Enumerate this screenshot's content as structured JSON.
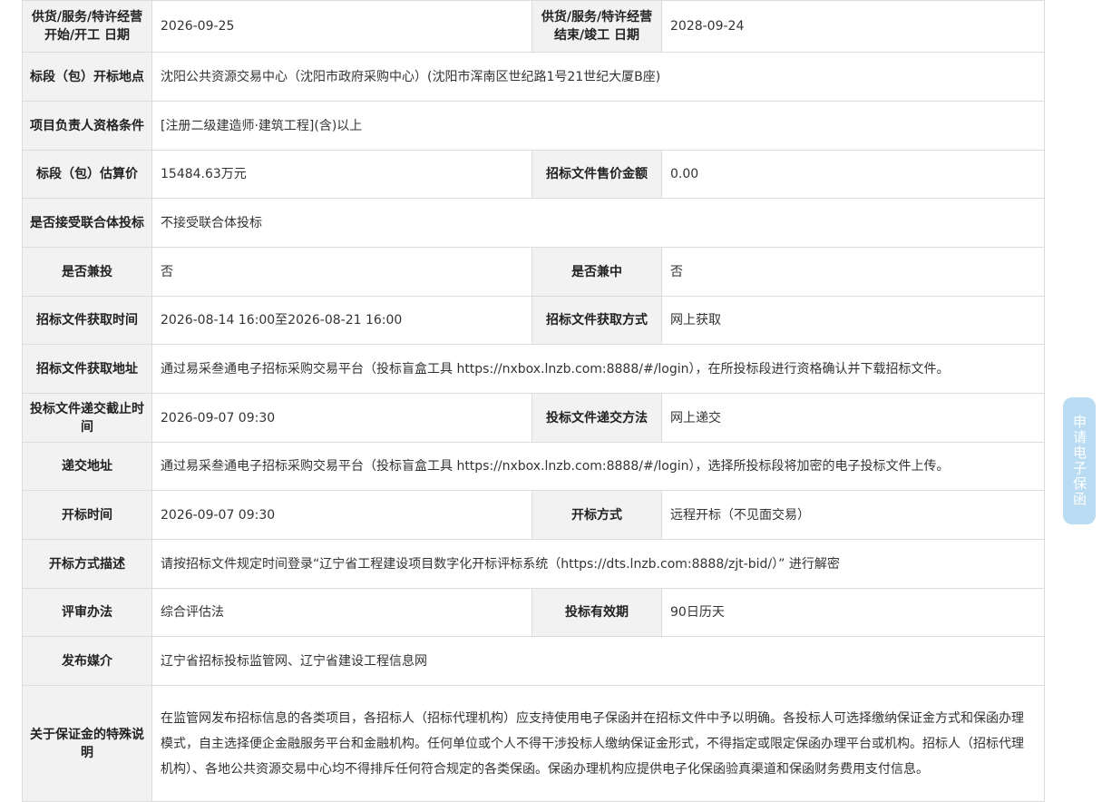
{
  "rows": {
    "start_date": {
      "label": "供货/服务/特许经营开始/开工 日期",
      "value": "2026-09-25"
    },
    "end_date": {
      "label": "供货/服务/特许经营结束/竣工 日期",
      "value": "2028-09-24"
    },
    "opening_location": {
      "label": "标段（包）开标地点",
      "value": "沈阳公共资源交易中心（沈阳市政府采购中心）(沈阳市浑南区世纪路1号21世纪大厦B座)"
    },
    "manager_qualification": {
      "label": "项目负责人资格条件",
      "value": "[注册二级建造师·建筑工程](含)以上"
    },
    "estimated_price": {
      "label": "标段（包）估算价",
      "value": "15484.63万元"
    },
    "doc_price": {
      "label": "招标文件售价金额",
      "value": "0.00"
    },
    "consortium": {
      "label": "是否接受联合体投标",
      "value": "不接受联合体投标"
    },
    "concurrent_bid": {
      "label": "是否兼投",
      "value": "否"
    },
    "concurrent_win": {
      "label": "是否兼中",
      "value": "否"
    },
    "doc_obtain_time": {
      "label": "招标文件获取时间",
      "value": "2026-08-14 16:00至2026-08-21 16:00"
    },
    "doc_obtain_method": {
      "label": "招标文件获取方式",
      "value": "网上获取"
    },
    "doc_obtain_address": {
      "label": "招标文件获取地址",
      "value": "通过易采叁通电子招标采购交易平台（投标盲盒工具 https://nxbox.lnzb.com:8888/#/login），在所投标段进行资格确认并下载招标文件。"
    },
    "submit_deadline": {
      "label": "投标文件递交截止时间",
      "value": "2026-09-07 09:30"
    },
    "submit_method": {
      "label": "投标文件递交方法",
      "value": "网上递交"
    },
    "submit_address": {
      "label": "递交地址",
      "value": "通过易采叁通电子招标采购交易平台（投标盲盒工具 https://nxbox.lnzb.com:8888/#/login），选择所投标段将加密的电子投标文件上传。"
    },
    "opening_time": {
      "label": "开标时间",
      "value": "2026-09-07 09:30"
    },
    "opening_method": {
      "label": "开标方式",
      "value": "远程开标（不见面交易）"
    },
    "opening_method_desc": {
      "label": "开标方式描述",
      "value": "请按招标文件规定时间登录“辽宁省工程建设项目数字化开标评标系统（https://dts.lnzb.com:8888/zjt-bid/）” 进行解密"
    },
    "evaluation_method": {
      "label": "评审办法",
      "value": "综合评估法"
    },
    "bid_validity": {
      "label": "投标有效期",
      "value": "90日历天"
    },
    "publish_media": {
      "label": "发布媒介",
      "value": "辽宁省招标投标监管网、辽宁省建设工程信息网"
    },
    "deposit_note": {
      "label": "关于保证金的特殊说明",
      "value": "在监管网发布招标信息的各类项目，各招标人（招标代理机构）应支持使用电子保函并在招标文件中予以明确。各投标人可选择缴纳保证金方式和保函办理模式，自主选择便企金融服务平台和金融机构。任何单位或个人不得干涉投标人缴纳保证金形式，不得指定或限定保函办理平台或机构。招标人（招标代理机构）、各地公共资源交易中心均不得排斥任何符合规定的各类保函。保函办理机构应提供电子化保函验真渠道和保函财务费用支付信息。"
    }
  },
  "side_button": {
    "label": "申请电子保函"
  },
  "colors": {
    "label_bg": "#f2f2f2",
    "border": "#dcdcdc",
    "side_button_bg": "#b9dcf3"
  }
}
